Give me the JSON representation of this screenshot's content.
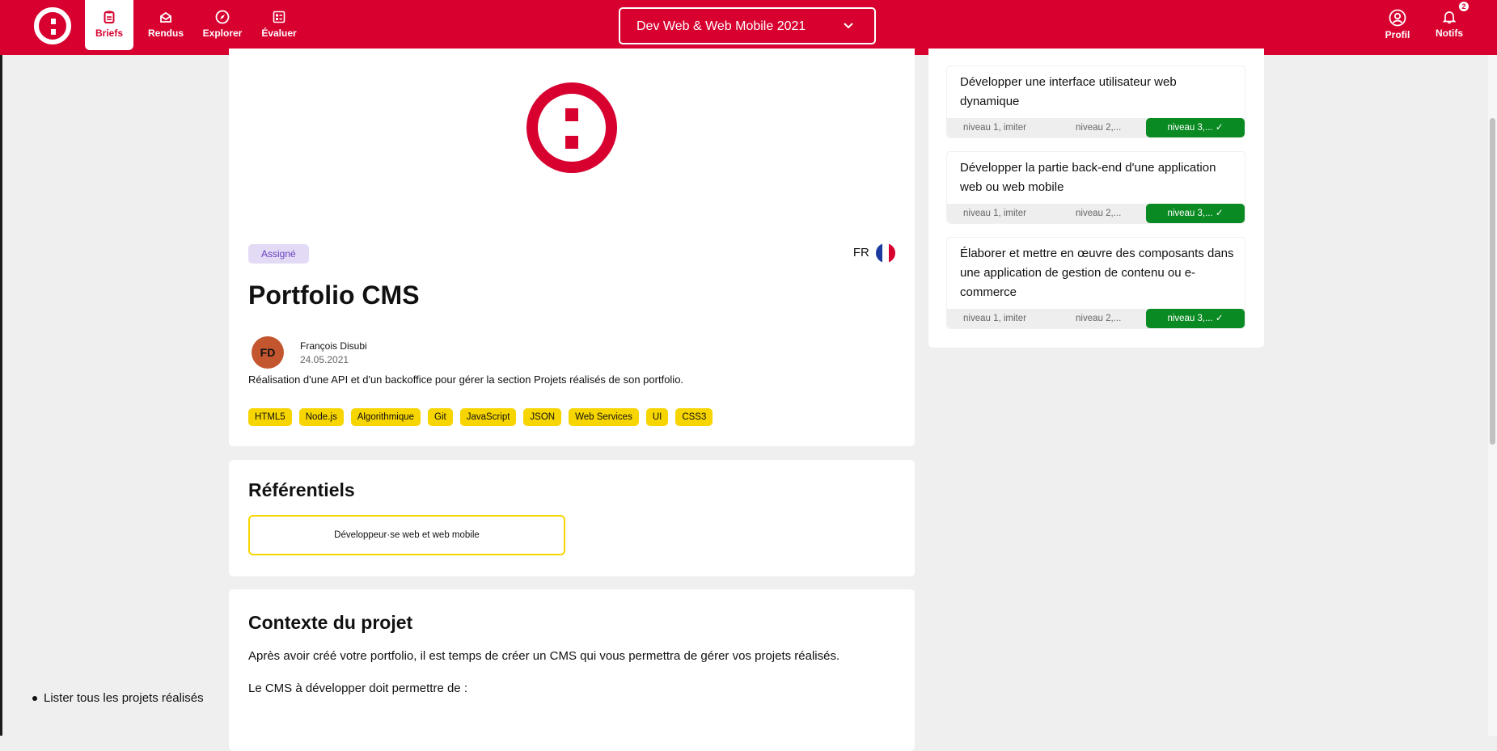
{
  "colors": {
    "brand": "#d7002f",
    "tag": "#f7d500",
    "success": "#0a8a22",
    "badge_bg": "#e3dbf6"
  },
  "nav": {
    "items": [
      {
        "label": "Briefs",
        "icon": "clipboard-icon"
      },
      {
        "label": "Rendus",
        "icon": "inbox-icon"
      },
      {
        "label": "Explorer",
        "icon": "compass-icon"
      },
      {
        "label": "Évaluer",
        "icon": "checklist-icon"
      }
    ],
    "cohort": "Dev Web & Web Mobile 2021",
    "profile_label": "Profil",
    "notifs_label": "Notifs",
    "notif_count": "2"
  },
  "brief": {
    "status": "Assigné",
    "lang": "FR",
    "title": "Portfolio CMS",
    "author_initials": "FD",
    "author": "François Disubi",
    "date": "24.05.2021",
    "description": "Réalisation d'une API et d'un backoffice pour gérer la section Projets réalisés de son portfolio.",
    "tags": [
      "HTML5",
      "Node.js",
      "Algorithmique",
      "Git",
      "JavaScript",
      "JSON",
      "Web Services",
      "UI",
      "CSS3"
    ]
  },
  "referentiels": {
    "title": "Référentiels",
    "items": [
      "Développeur·se web et web mobile"
    ]
  },
  "context": {
    "title": "Contexte du projet",
    "p1": "Après avoir créé votre portfolio, il est temps de créer un CMS qui vous permettra de gérer vos projets réalisés.",
    "p2": "Le CMS à développer doit permettre de :",
    "li1": "Lister tous les projets réalisés"
  },
  "competences": [
    {
      "title": "Développer une interface utilisateur web dynamique",
      "levels": [
        "niveau 1, imiter",
        "niveau 2,...",
        "niveau 3,..."
      ]
    },
    {
      "title": "Développer la partie back-end d'une application web ou web mobile",
      "levels": [
        "niveau 1, imiter",
        "niveau 2,...",
        "niveau 3,..."
      ]
    },
    {
      "title": "Élaborer et mettre en œuvre des composants dans une application de gestion de contenu ou e-commerce",
      "levels": [
        "niveau 1, imiter",
        "niveau 2,...",
        "niveau 3,..."
      ]
    }
  ]
}
